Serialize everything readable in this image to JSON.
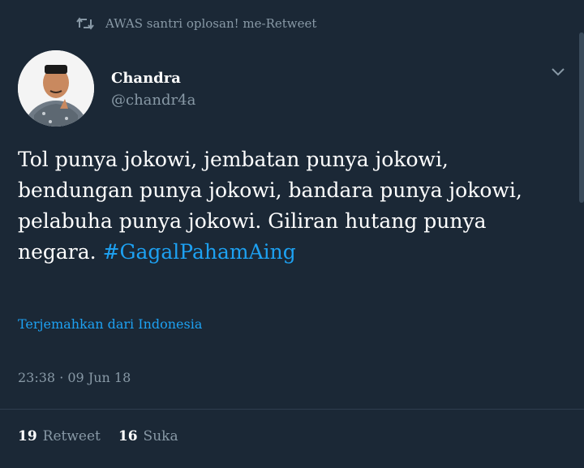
{
  "retweet_context": {
    "icon": "retweet-icon",
    "text": "AWAS santri oplosan! me-Retweet"
  },
  "author": {
    "name": "Chandra",
    "handle": "@chandr4a",
    "avatar_icon": "avatar"
  },
  "tweet": {
    "text_before_hashtag": "Tol punya jokowi, jembatan punya jokowi,\nbendungan punya jokowi, bandara punya jokowi,\npelabuha punya jokowi. Giliran hutang punya\nnegara. ",
    "hashtag": "#GagalPahamAing"
  },
  "translate_link": "Terjemahkan dari Indonesia",
  "timestamp": "23:38 · 09 Jun 18",
  "stats": {
    "retweets_count": "19",
    "retweets_label": "Retweet",
    "likes_count": "16",
    "likes_label": "Suka"
  },
  "colors": {
    "background": "#1b2836",
    "accent": "#1da1f2",
    "secondary_text": "#8899a6"
  }
}
